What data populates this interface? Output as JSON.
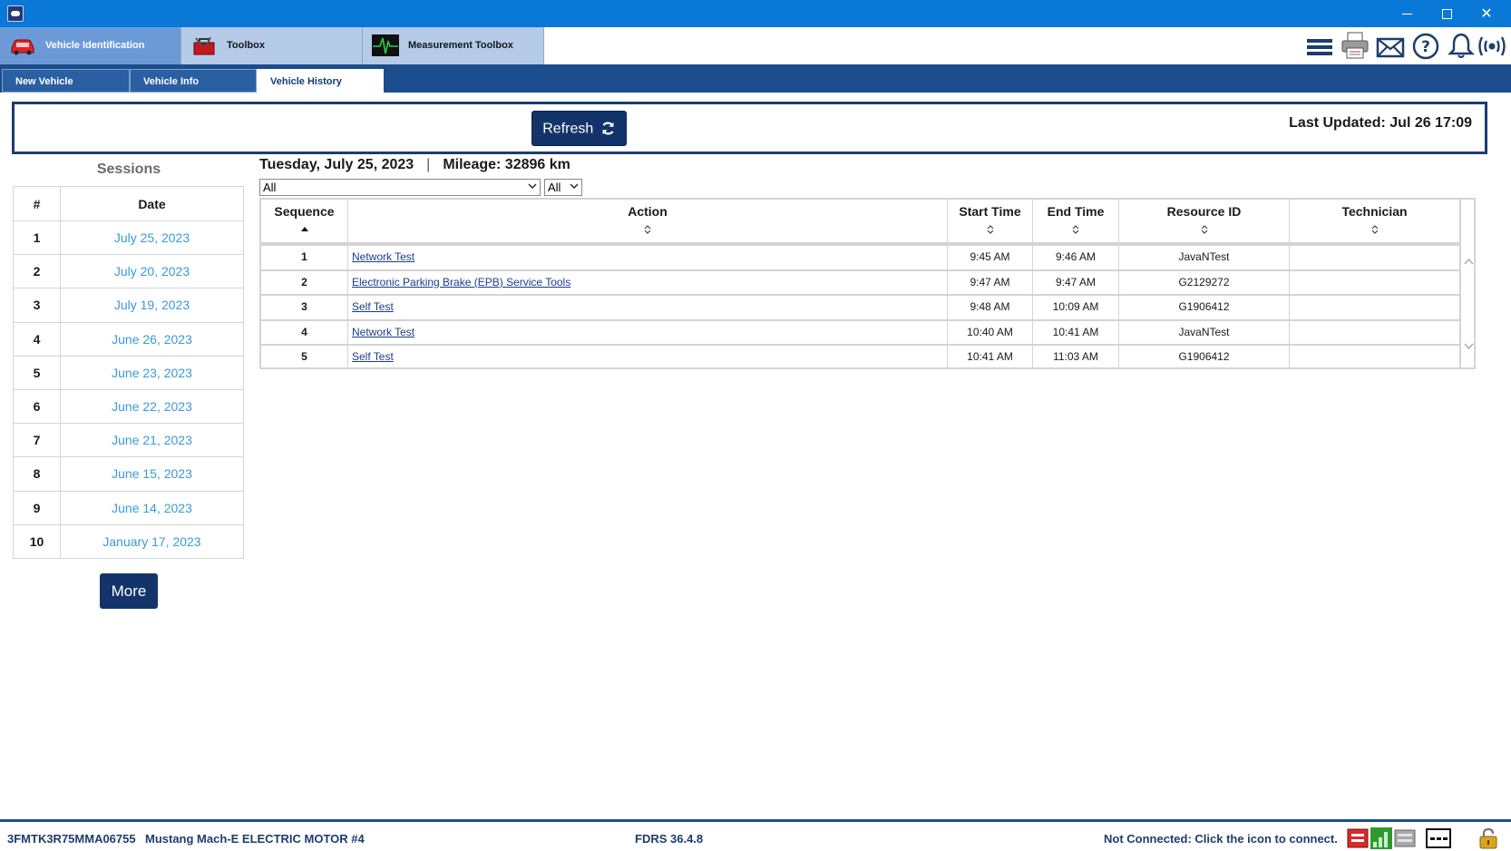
{
  "window": {
    "app_icon": "fdrs-app-icon"
  },
  "app_tabs": [
    {
      "label": "Vehicle Identification",
      "icon": "car-icon"
    },
    {
      "label": "Toolbox",
      "icon": "toolbox-icon"
    },
    {
      "label": "Measurement Toolbox",
      "icon": "waveform-icon"
    }
  ],
  "toolbar_icons": [
    "menu-icon",
    "printer-icon",
    "mail-icon",
    "help-icon",
    "bell-icon",
    "wireless-icon"
  ],
  "sub_tabs": [
    {
      "label": "New Vehicle"
    },
    {
      "label": "Vehicle Info"
    },
    {
      "label": "Vehicle History"
    }
  ],
  "refresh": {
    "label": "Refresh",
    "last_updated": "Last Updated: Jul 26 17:09"
  },
  "sessions": {
    "title": "Sessions",
    "headers": {
      "num": "#",
      "date": "Date"
    },
    "rows": [
      {
        "num": "1",
        "date": "July 25, 2023"
      },
      {
        "num": "2",
        "date": "July 20, 2023"
      },
      {
        "num": "3",
        "date": "July 19, 2023"
      },
      {
        "num": "4",
        "date": "June 26, 2023"
      },
      {
        "num": "5",
        "date": "June 23, 2023"
      },
      {
        "num": "6",
        "date": "June 22, 2023"
      },
      {
        "num": "7",
        "date": "June 21, 2023"
      },
      {
        "num": "8",
        "date": "June 15, 2023"
      },
      {
        "num": "9",
        "date": "June 14, 2023"
      },
      {
        "num": "10",
        "date": "January 17, 2023"
      }
    ],
    "more_label": "More"
  },
  "session_detail": {
    "date": "Tuesday, July 25, 2023",
    "separator": "|",
    "mileage": "Mileage: 32896 km",
    "filter_action": "All",
    "filter_status": "All",
    "headers": {
      "sequence": "Sequence",
      "action": "Action",
      "start_time": "Start Time",
      "end_time": "End Time",
      "resource_id": "Resource ID",
      "technician": "Technician"
    },
    "rows": [
      {
        "sequence": "1",
        "action": "Network Test",
        "start_time": "9:45 AM",
        "end_time": "9:46 AM",
        "resource_id": "JavaNTest",
        "technician": ""
      },
      {
        "sequence": "2",
        "action": "Electronic Parking Brake (EPB) Service Tools",
        "start_time": "9:47 AM",
        "end_time": "9:47 AM",
        "resource_id": "G2129272",
        "technician": ""
      },
      {
        "sequence": "3",
        "action": "Self Test",
        "start_time": "9:48 AM",
        "end_time": "10:09 AM",
        "resource_id": "G1906412",
        "technician": ""
      },
      {
        "sequence": "4",
        "action": "Network Test",
        "start_time": "10:40 AM",
        "end_time": "10:41 AM",
        "resource_id": "JavaNTest",
        "technician": ""
      },
      {
        "sequence": "5",
        "action": "Self Test",
        "start_time": "10:41 AM",
        "end_time": "11:03 AM",
        "resource_id": "G1906412",
        "technician": ""
      }
    ]
  },
  "status_bar": {
    "vin": "3FMTK3R75MMA06755",
    "model": "Mustang Mach-E ELECTRIC MOTOR #4",
    "version": "FDRS 36.4.8",
    "connection": "Not Connected: Click the icon to connect.",
    "icons": [
      "vci-red-icon",
      "signal-green-icon",
      "vci-gray-icon",
      "dashes-icon",
      "lock-icon"
    ]
  },
  "colors": {
    "title_bar": "#0a78d7",
    "navy": "#1b4d8c",
    "button": "#12346a",
    "session_date": "#3a9ad6",
    "active_app_tab": "#6b9ad7",
    "inactive_app_tab": "#b5cbe7"
  }
}
